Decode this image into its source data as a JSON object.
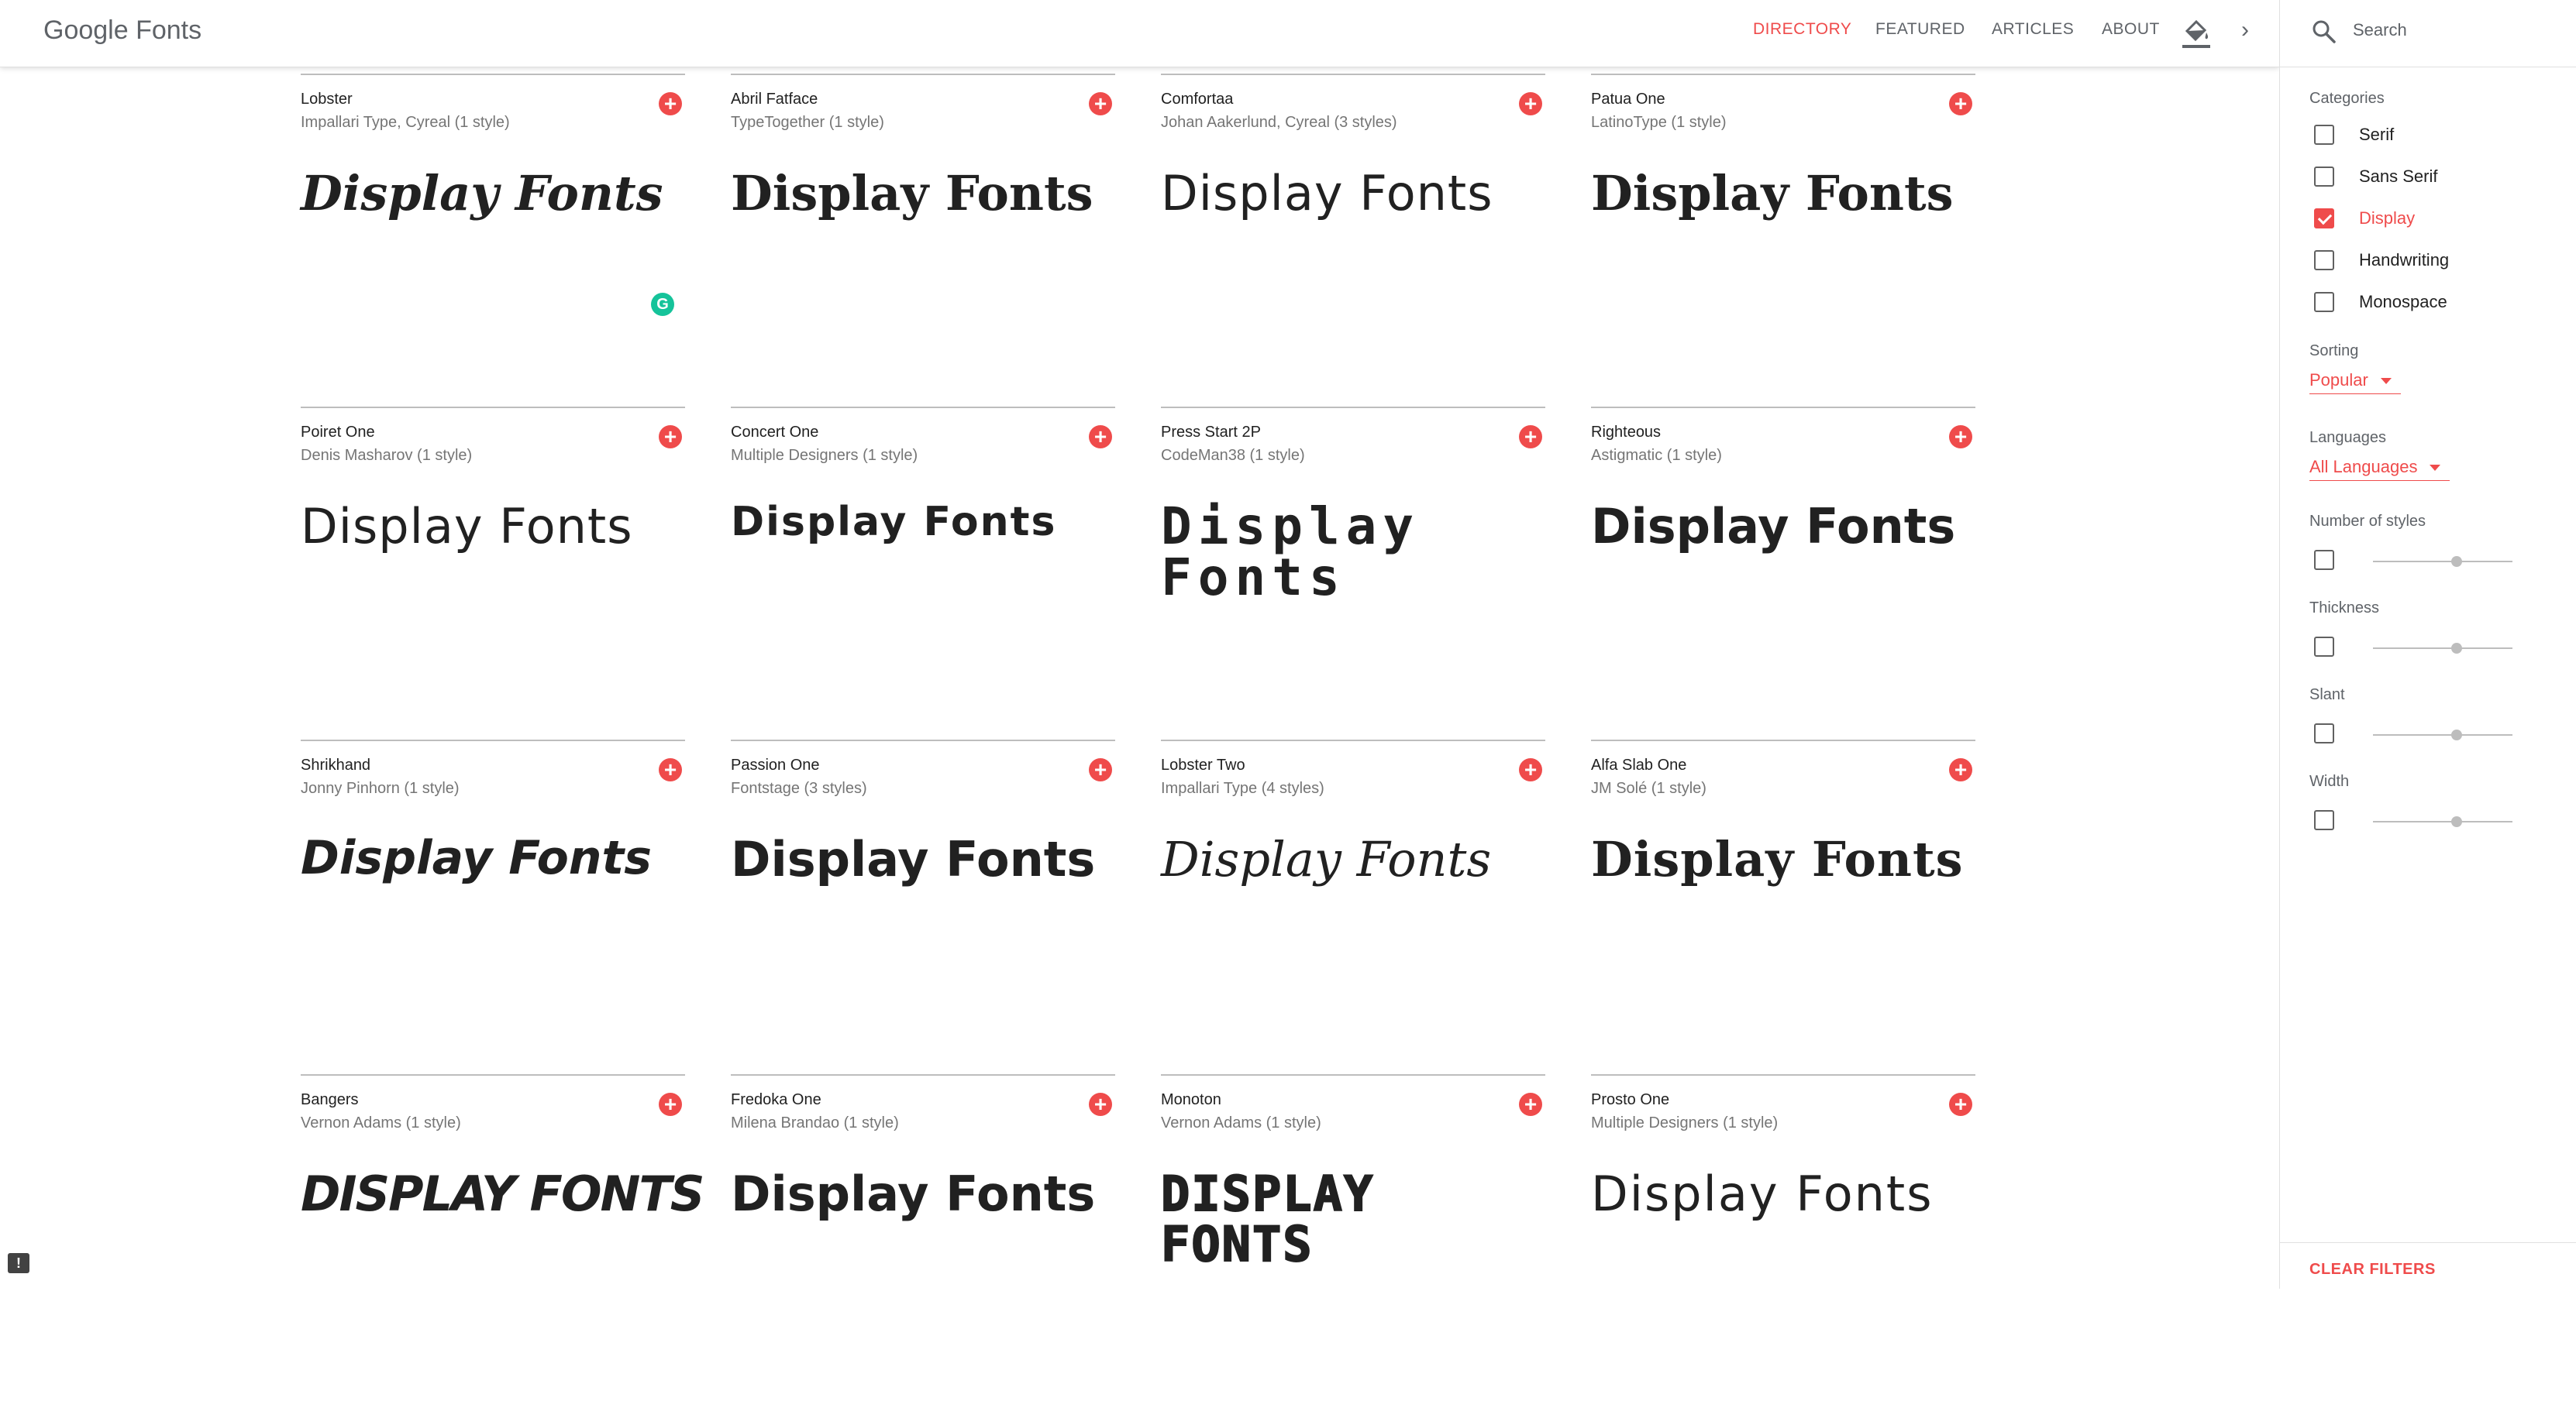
{
  "header": {
    "logo": "Google Fonts",
    "nav": [
      "DIRECTORY",
      "FEATURED",
      "ARTICLES",
      "ABOUT"
    ],
    "active_nav": "DIRECTORY",
    "chevron": "›"
  },
  "sidebar": {
    "search_placeholder": "Search",
    "categories_label": "Categories",
    "categories": [
      {
        "label": "Serif",
        "checked": false
      },
      {
        "label": "Sans Serif",
        "checked": false
      },
      {
        "label": "Display",
        "checked": true
      },
      {
        "label": "Handwriting",
        "checked": false
      },
      {
        "label": "Monospace",
        "checked": false
      }
    ],
    "sorting_label": "Sorting",
    "sorting_value": "Popular",
    "languages_label": "Languages",
    "languages_value": "All Languages",
    "filters": [
      {
        "label": "Number of styles",
        "value": 0.6
      },
      {
        "label": "Thickness",
        "value": 0.6
      },
      {
        "label": "Slant",
        "value": 0.6
      },
      {
        "label": "Width",
        "value": 0.6
      }
    ],
    "clear_label": "CLEAR FILTERS"
  },
  "add_glyph": "+",
  "sample_text": "Display Fonts",
  "fonts": [
    {
      "name": "Lobster",
      "meta": "Impallari Type, Cyreal (1 style)",
      "style": "lobster"
    },
    {
      "name": "Abril Fatface",
      "meta": "TypeTogether (1 style)",
      "style": "abril"
    },
    {
      "name": "Comfortaa",
      "meta": "Johan Aakerlund, Cyreal (3 styles)",
      "style": "comfortaa"
    },
    {
      "name": "Patua One",
      "meta": "LatinoType (1 style)",
      "style": "patua"
    },
    {
      "name": "Poiret One",
      "meta": "Denis Masharov (1 style)",
      "style": "poiret"
    },
    {
      "name": "Concert One",
      "meta": "Multiple Designers (1 style)",
      "style": "concert"
    },
    {
      "name": "Press Start 2P",
      "meta": "CodeMan38 (1 style)",
      "style": "press"
    },
    {
      "name": "Righteous",
      "meta": "Astigmatic (1 style)",
      "style": "righteous"
    },
    {
      "name": "Shrikhand",
      "meta": "Jonny Pinhorn (1 style)",
      "style": "shrikhand"
    },
    {
      "name": "Passion One",
      "meta": "Fontstage (3 styles)",
      "style": "passion"
    },
    {
      "name": "Lobster Two",
      "meta": "Impallari Type (4 styles)",
      "style": "lobstertwo"
    },
    {
      "name": "Alfa Slab One",
      "meta": "JM Solé (1 style)",
      "style": "alfa"
    },
    {
      "name": "Bangers",
      "meta": "Vernon Adams (1 style)",
      "style": "bangers"
    },
    {
      "name": "Fredoka One",
      "meta": "Milena Brandao (1 style)",
      "style": "fredoka"
    },
    {
      "name": "Monoton",
      "meta": "Vernon Adams (1 style)",
      "style": "monoton"
    },
    {
      "name": "Prosto One",
      "meta": "Multiple Designers (1 style)",
      "style": "prosto"
    }
  ],
  "overlay": {
    "grammarly_glyph": "G",
    "feedback_glyph": "!"
  },
  "colors": {
    "accent": "#ef4b4b",
    "text": "#212121",
    "muted": "#757575",
    "divider": "#bdbdbd"
  }
}
